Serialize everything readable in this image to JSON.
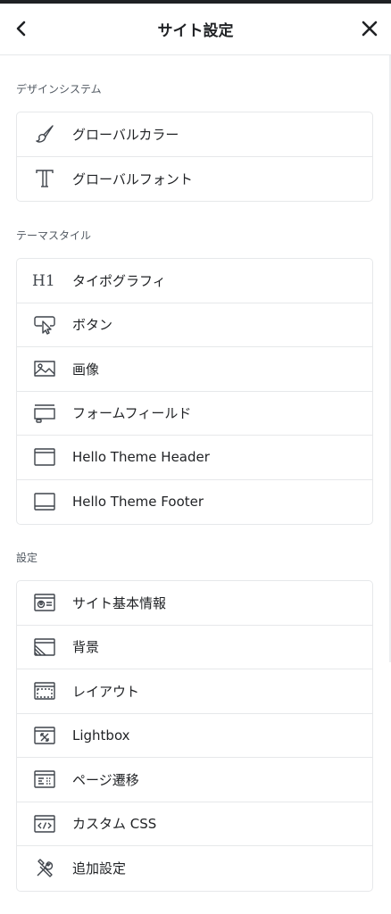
{
  "header": {
    "title": "サイト設定"
  },
  "sections": [
    {
      "title": "デザインシステム",
      "items": [
        {
          "label": "グローバルカラー",
          "icon": "brush-icon"
        },
        {
          "label": "グローバルフォント",
          "icon": "typography-icon"
        }
      ]
    },
    {
      "title": "テーマスタイル",
      "items": [
        {
          "label": "タイポグラフィ",
          "icon": "h1-icon"
        },
        {
          "label": "ボタン",
          "icon": "button-cursor-icon"
        },
        {
          "label": "画像",
          "icon": "image-icon"
        },
        {
          "label": "フォームフィールド",
          "icon": "form-field-icon"
        },
        {
          "label": "Hello Theme Header",
          "icon": "header-layout-icon"
        },
        {
          "label": "Hello Theme Footer",
          "icon": "footer-layout-icon"
        }
      ]
    },
    {
      "title": "設定",
      "items": [
        {
          "label": "サイト基本情報",
          "icon": "site-identity-icon"
        },
        {
          "label": "背景",
          "icon": "background-icon"
        },
        {
          "label": "レイアウト",
          "icon": "layout-icon"
        },
        {
          "label": "Lightbox",
          "icon": "lightbox-icon"
        },
        {
          "label": "ページ遷移",
          "icon": "page-transition-icon"
        },
        {
          "label": "カスタム CSS",
          "icon": "custom-css-icon"
        },
        {
          "label": "追加設定",
          "icon": "tools-icon"
        }
      ]
    }
  ]
}
